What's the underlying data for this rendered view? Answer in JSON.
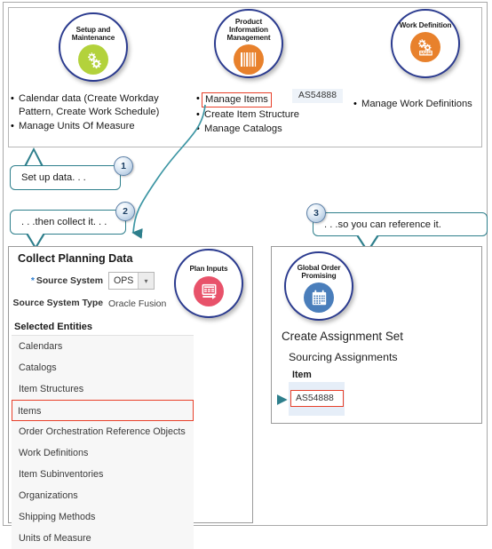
{
  "top_panel": {
    "offerings": [
      {
        "name": "Setup and Maintenance",
        "icon": "gears-icon",
        "icon_color": "#b3d23c",
        "tasks": [
          {
            "text": "Calendar data (Create Workday Pattern, Create Work Schedule)",
            "highlighted": false
          },
          {
            "text": "Manage Units Of Measure",
            "highlighted": false
          }
        ]
      },
      {
        "name": "Product Information Management",
        "icon": "barcode-icon",
        "icon_color": "#e8812c",
        "tasks": [
          {
            "text": "Manage Items",
            "highlighted": true
          },
          {
            "text": "Create Item Structure",
            "highlighted": false
          },
          {
            "text": "Manage Catalogs",
            "highlighted": false
          }
        ]
      },
      {
        "name": "Work Definition",
        "icon": "work-definition-icon",
        "icon_color": "#e8812c",
        "tasks": [
          {
            "text": "Manage Work Definitions",
            "highlighted": false
          }
        ]
      }
    ],
    "item_code_badge": "AS54888"
  },
  "callouts": [
    {
      "number": "1",
      "text": "Set up data. . ."
    },
    {
      "number": "2",
      "text": ". . .then collect it. . ."
    },
    {
      "number": "3",
      "text": ". . .so you can reference  it."
    }
  ],
  "collect_planning_data": {
    "title": "Collect Planning Data",
    "plan_inputs_badge": {
      "name": "Plan Inputs",
      "icon": "plan-inputs-icon",
      "icon_color": "#e8526a"
    },
    "fields": {
      "source_system_label": "Source System",
      "source_system_required": "*",
      "source_system_value": "OPS",
      "source_system_type_label": "Source System Type",
      "source_system_type_value": "Oracle Fusion"
    },
    "selected_entities_label": "Selected Entities",
    "entities": [
      {
        "label": "Calendars",
        "highlighted": false
      },
      {
        "label": "Catalogs",
        "highlighted": false
      },
      {
        "label": "Item Structures",
        "highlighted": false
      },
      {
        "label": "Items",
        "highlighted": true
      },
      {
        "label": "Order Orchestration Reference Objects",
        "highlighted": false
      },
      {
        "label": "Work Definitions",
        "highlighted": false
      },
      {
        "label": "Item Subinventories",
        "highlighted": false
      },
      {
        "label": "Organizations",
        "highlighted": false
      },
      {
        "label": "Shipping Methods",
        "highlighted": false
      },
      {
        "label": "Units of Measure",
        "highlighted": false
      }
    ]
  },
  "global_order_promising": {
    "badge": {
      "name": "Global Order Promising",
      "icon": "calendar-icon",
      "icon_color": "#4a7ebb"
    },
    "heading": "Create Assignment Set",
    "subheading": "Sourcing Assignments",
    "field_label": "Item",
    "field_value": "AS54888"
  },
  "colors": {
    "circle_border": "#2b3b8f",
    "callout_border": "#2e7f8c",
    "highlight_red": "#e8402a",
    "connector_teal": "#2e7f8c",
    "required_star_blue": "#2f7fd0"
  }
}
